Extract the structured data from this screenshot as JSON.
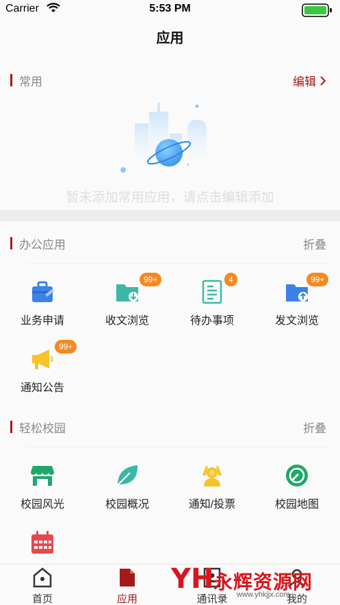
{
  "status_bar": {
    "carrier": "Carrier",
    "time": "5:53 PM"
  },
  "header": {
    "title": "应用"
  },
  "favorites": {
    "title": "常用",
    "edit_label": "编辑",
    "empty_text": "暂未添加常用应用，请点击编辑添加"
  },
  "office": {
    "title": "办公应用",
    "collapse_label": "折叠",
    "items": [
      {
        "label": "业务申请",
        "icon": "toolbox-icon",
        "badge": ""
      },
      {
        "label": "收文浏览",
        "icon": "folder-download-icon",
        "badge": "99+"
      },
      {
        "label": "待办事项",
        "icon": "document-list-icon",
        "badge": "4"
      },
      {
        "label": "发文浏览",
        "icon": "folder-upload-icon",
        "badge": "99+"
      },
      {
        "label": "通知公告",
        "icon": "megaphone-icon",
        "badge": "99+"
      }
    ]
  },
  "campus": {
    "title": "轻松校园",
    "collapse_label": "折叠",
    "items": [
      {
        "label": "校园风光",
        "icon": "store-icon"
      },
      {
        "label": "校园概况",
        "icon": "leaf-icon"
      },
      {
        "label": "通知/投票",
        "icon": "vote-people-icon"
      },
      {
        "label": "校园地图",
        "icon": "compass-icon"
      }
    ]
  },
  "tab_bar": {
    "items": [
      {
        "label": "首页",
        "icon": "home-icon",
        "active": false
      },
      {
        "label": "应用",
        "icon": "document-icon",
        "active": true
      },
      {
        "label": "通讯录",
        "icon": "contacts-icon",
        "active": false
      },
      {
        "label": "我的",
        "icon": "profile-icon",
        "active": false
      }
    ]
  },
  "watermark": {
    "logo": "YH",
    "name": "永辉资源网",
    "url": "www.yhkjjx.com"
  },
  "colors": {
    "accent": "#a31b1b",
    "badge": "#f5891f",
    "blue": "#3b82e6",
    "teal": "#3bb8a5",
    "yellow": "#f6c32b",
    "green": "#1fa86a",
    "red": "#e5484d"
  }
}
